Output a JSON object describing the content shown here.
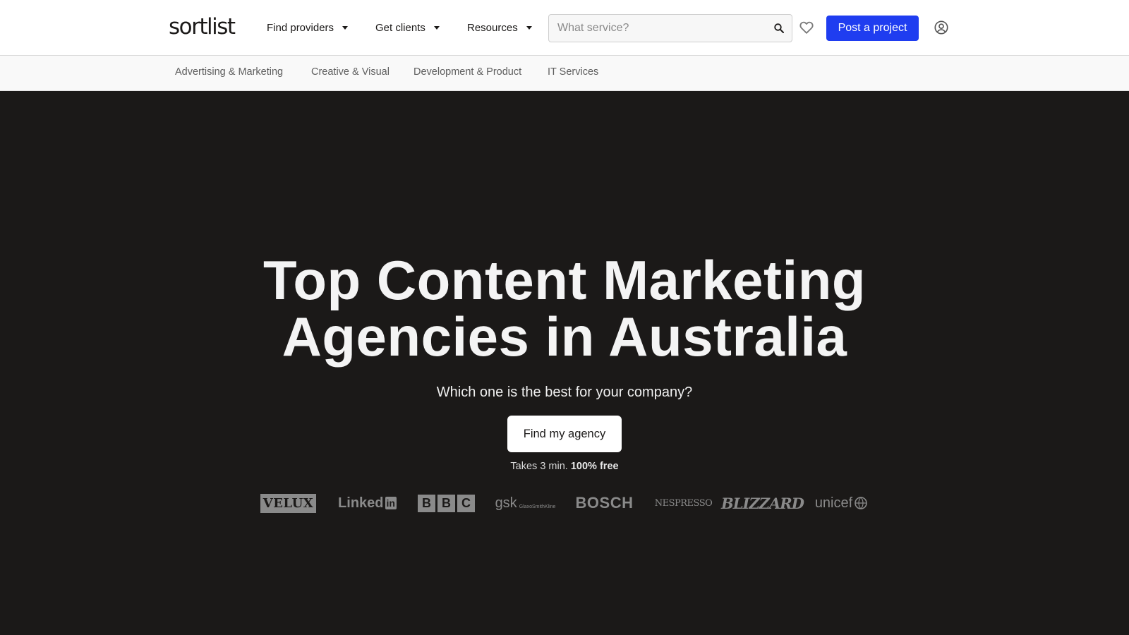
{
  "header": {
    "logo": "sortlist",
    "nav": [
      {
        "label": "Find providers"
      },
      {
        "label": "Get clients"
      },
      {
        "label": "Resources"
      }
    ],
    "search": {
      "placeholder": "What service?",
      "value": ""
    },
    "post_button": "Post a project",
    "icons": {
      "search": "search-icon",
      "favorites": "heart-icon",
      "account": "account-icon"
    }
  },
  "categories": [
    "Advertising & Marketing",
    "Creative & Visual",
    "Development & Product",
    "IT Services"
  ],
  "hero": {
    "title_line1": "Top Content Marketing",
    "title_line2": "Agencies in Australia",
    "subtitle": "Which one is the best for your company?",
    "cta": "Find my agency",
    "note_text": "Takes 3 min.",
    "note_bold": "100% free"
  },
  "brands": {
    "velux": "VELUX",
    "linkedin_text": "Linked",
    "linkedin_box": "in",
    "bbc": [
      "B",
      "B",
      "C"
    ],
    "gsk": "gsk",
    "gsk_sub": "GlaxoSmithKline",
    "bosch": "BOSCH",
    "nespresso": "NESPRESSO",
    "blizzard": "BLIZZARD",
    "unicef": "unicef"
  },
  "colors": {
    "brand_accent": "#1f3df0",
    "hero_background": "#1b1918",
    "logo_gray": "#8a8a8a"
  }
}
